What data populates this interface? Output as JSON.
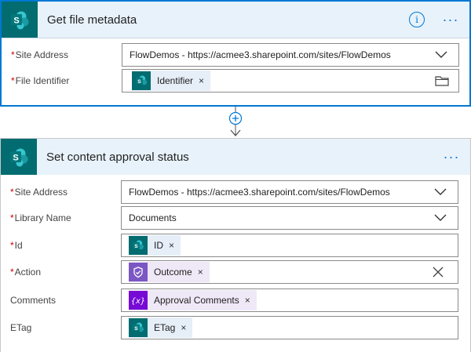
{
  "card1": {
    "title": "Get file metadata",
    "header_icons": [
      "info-icon",
      "more-icon"
    ],
    "fields": {
      "site_address": {
        "label": "Site Address",
        "required": true,
        "value": "FlowDemos - https://acmee3.sharepoint.com/sites/FlowDemos"
      },
      "file_identifier": {
        "label": "File Identifier",
        "required": true,
        "token": "Identifier"
      }
    }
  },
  "connector": {
    "icon": "add-step-icon"
  },
  "card2": {
    "title": "Set content approval status",
    "fields": {
      "site_address": {
        "label": "Site Address",
        "required": true,
        "value": "FlowDemos - https://acmee3.sharepoint.com/sites/FlowDemos"
      },
      "library_name": {
        "label": "Library Name",
        "required": true,
        "value": "Documents"
      },
      "id": {
        "label": "Id",
        "required": true,
        "token": "ID"
      },
      "action": {
        "label": "Action",
        "required": true,
        "token": "Outcome"
      },
      "comments": {
        "label": "Comments",
        "required": false,
        "token": "Approval Comments"
      },
      "etag": {
        "label": "ETag",
        "required": false,
        "token": "ETag"
      }
    }
  },
  "required_marker": "*",
  "token_remove": "×",
  "colors": {
    "accent": "#0078d4",
    "sharepoint": "#036c70",
    "approvals": "#7b57c4",
    "variables": "#770bd6",
    "header_bg": "#e8f2fb",
    "required": "#cc0000"
  }
}
